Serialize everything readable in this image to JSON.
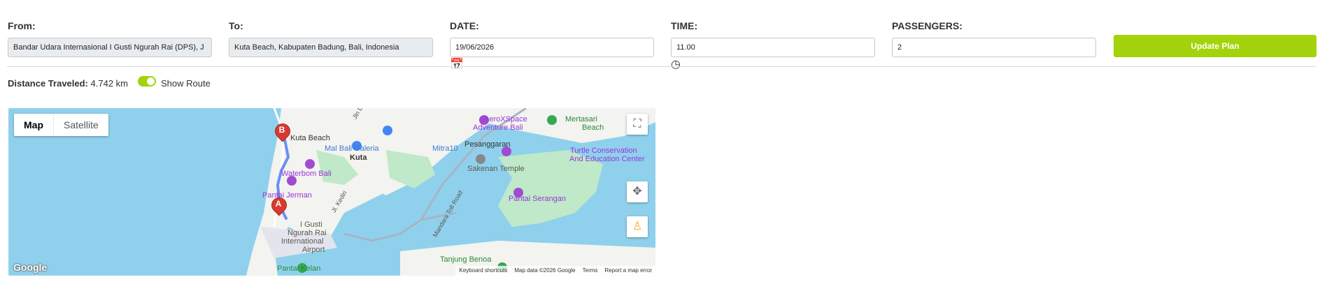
{
  "form": {
    "from_label": "From:",
    "from_value": "Bandar Udara Internasional I Gusti Ngurah Rai (DPS), J",
    "to_label": "To:",
    "to_value": "Kuta Beach, Kabupaten Badung, Bali, Indonesia",
    "date_label": "DATE:",
    "date_value": "19/06/2026",
    "time_label": "TIME:",
    "time_value": "11.00",
    "passengers_label": "PASSENGERS:",
    "passengers_value": "2",
    "update_label": "Update Plan"
  },
  "route": {
    "distance_label": "Distance Traveled:",
    "distance_value": "4.742 km",
    "show_route_label": "Show Route",
    "show_route_on": true
  },
  "map": {
    "type_map": "Map",
    "type_satellite": "Satellite",
    "labels": {
      "kuta_beach": "Kuta Beach",
      "mal_bali_galeria": "Mal Bali Galeria",
      "kuta": "Kuta",
      "waterbom": "Waterbom Bali",
      "pantai_jerman": "Pantai Jerman",
      "airport_1": "I Gusti",
      "airport_2": "Ngurah Rai",
      "airport_3": "International",
      "airport_4": "Airport",
      "pantai_kelan": "Pantai Kelan",
      "mitra10": "Mitra10",
      "pesanggaran": "Pesanggaran",
      "sakenan": "Sakenan Temple",
      "aeroxspace_1": "AeroXSpace",
      "aeroxspace_2": "Adventure Bali",
      "mertasari_1": "Mertasari",
      "mertasari_2": "Beach",
      "turtle_1": "Turtle Conservation",
      "turtle_2": "And Education Center",
      "pantai_serangan": "Pantai Serangan",
      "tanjung_benoa": "Tanjung Benoa",
      "mandara": "Mandara Toll Road",
      "jl_kediri": "Jl. Kediri",
      "jln_legian": "Jln Legian"
    },
    "markers": {
      "a": "A",
      "b": "B"
    },
    "footer": {
      "shortcuts": "Keyboard shortcuts",
      "data": "Map data ©2026 Google",
      "terms": "Terms",
      "report": "Report a map error"
    },
    "google": "Google",
    "colors": {
      "water": "#8fd1ec",
      "land": "#f3f3ef",
      "green": "#bfe9c8",
      "route": "#6c8df5",
      "accent": "#a3d30a"
    }
  }
}
